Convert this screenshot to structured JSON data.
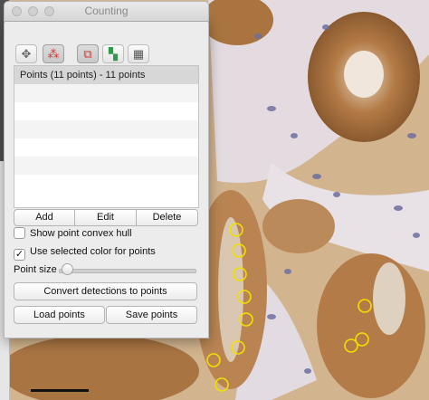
{
  "window": {
    "title": "Counting"
  },
  "toolbar": {
    "tools": [
      {
        "name": "move-tool",
        "icon": "move-arrows-icon",
        "glyph": "✥",
        "color": "#666666",
        "active": false
      },
      {
        "name": "points-tool",
        "icon": "points-cluster-icon",
        "glyph": "⁂",
        "color": "#d03a3a",
        "active": true
      },
      {
        "name": "detection-overlay-toggle",
        "icon": "overlay-circles-icon",
        "glyph": "⧉",
        "color": "#d03a3a",
        "active": true
      },
      {
        "name": "annotation-overlay-toggle",
        "icon": "annotation-dots-icon",
        "glyph": "▚",
        "color": "#2f9a4a",
        "active": false
      },
      {
        "name": "grid-overlay-toggle",
        "icon": "grid-icon",
        "glyph": "▦",
        "color": "#555555",
        "active": false
      }
    ]
  },
  "points_list": {
    "items": [
      "Points (11 points) - 11 points"
    ],
    "selected_index": 0
  },
  "buttons": {
    "add": "Add",
    "edit": "Edit",
    "delete": "Delete"
  },
  "options": {
    "convex_hull": {
      "label": "Show point convex hull",
      "checked": false
    },
    "selected_color": {
      "label": "Use selected color for points",
      "checked": true
    }
  },
  "point_size": {
    "label": "Point size",
    "value_fraction": 0.02
  },
  "actions": {
    "convert": "Convert detections to points",
    "load": "Load points",
    "save": "Save points"
  },
  "colors": {
    "point_outline": "#f0e000"
  }
}
